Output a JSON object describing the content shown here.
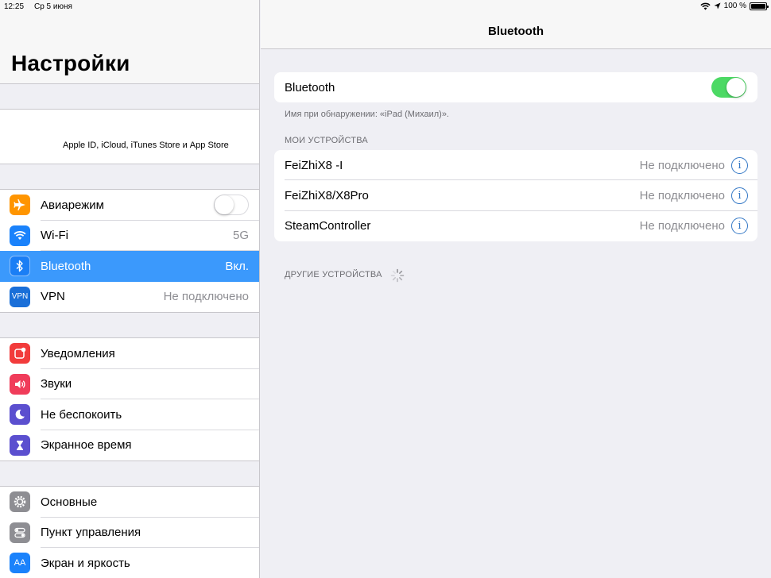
{
  "status": {
    "time": "12:25",
    "date": "Ср 5 июня",
    "battery": "100 %"
  },
  "sidebar": {
    "title": "Настройки",
    "appleid_subtitle": "Apple ID, iCloud, iTunes Store и App Store",
    "group1": [
      {
        "label": "Авиарежим",
        "value": "",
        "color": "#ff9500"
      },
      {
        "label": "Wi-Fi",
        "value": "5G",
        "color": "#1a82fb"
      },
      {
        "label": "Bluetooth",
        "value": "Вкл.",
        "color": "#1a82fb"
      },
      {
        "label": "VPN",
        "value": "Не подключено",
        "color": "#1a6fd8",
        "icon_text": "VPN"
      }
    ],
    "group2": [
      {
        "label": "Уведомления",
        "color": "#f23b3b"
      },
      {
        "label": "Звуки",
        "color": "#f03c5a"
      },
      {
        "label": "Не беспокоить",
        "color": "#5b4fcf"
      },
      {
        "label": "Экранное время",
        "color": "#5b4fcf"
      }
    ],
    "group3": [
      {
        "label": "Основные",
        "color": "#8e8e93"
      },
      {
        "label": "Пункт управления",
        "color": "#8e8e93"
      },
      {
        "label": "Экран и яркость",
        "color": "#1a82fb",
        "icon_text": "AA"
      }
    ]
  },
  "detail": {
    "nav_title": "Bluetooth",
    "bluetooth_label": "Bluetooth",
    "discoverable_note": "Имя при обнаружении: «iPad (Михаил)».",
    "my_devices_header": "МОИ УСТРОЙСТВА",
    "devices": [
      {
        "name": "FeiZhiX8 -I",
        "status": "Не подключено"
      },
      {
        "name": "FeiZhiX8/X8Pro",
        "status": "Не подключено"
      },
      {
        "name": "SteamController",
        "status": "Не подключено"
      }
    ],
    "other_devices_header": "ДРУГИЕ УСТРОЙСТВА",
    "info_glyph": "i"
  }
}
